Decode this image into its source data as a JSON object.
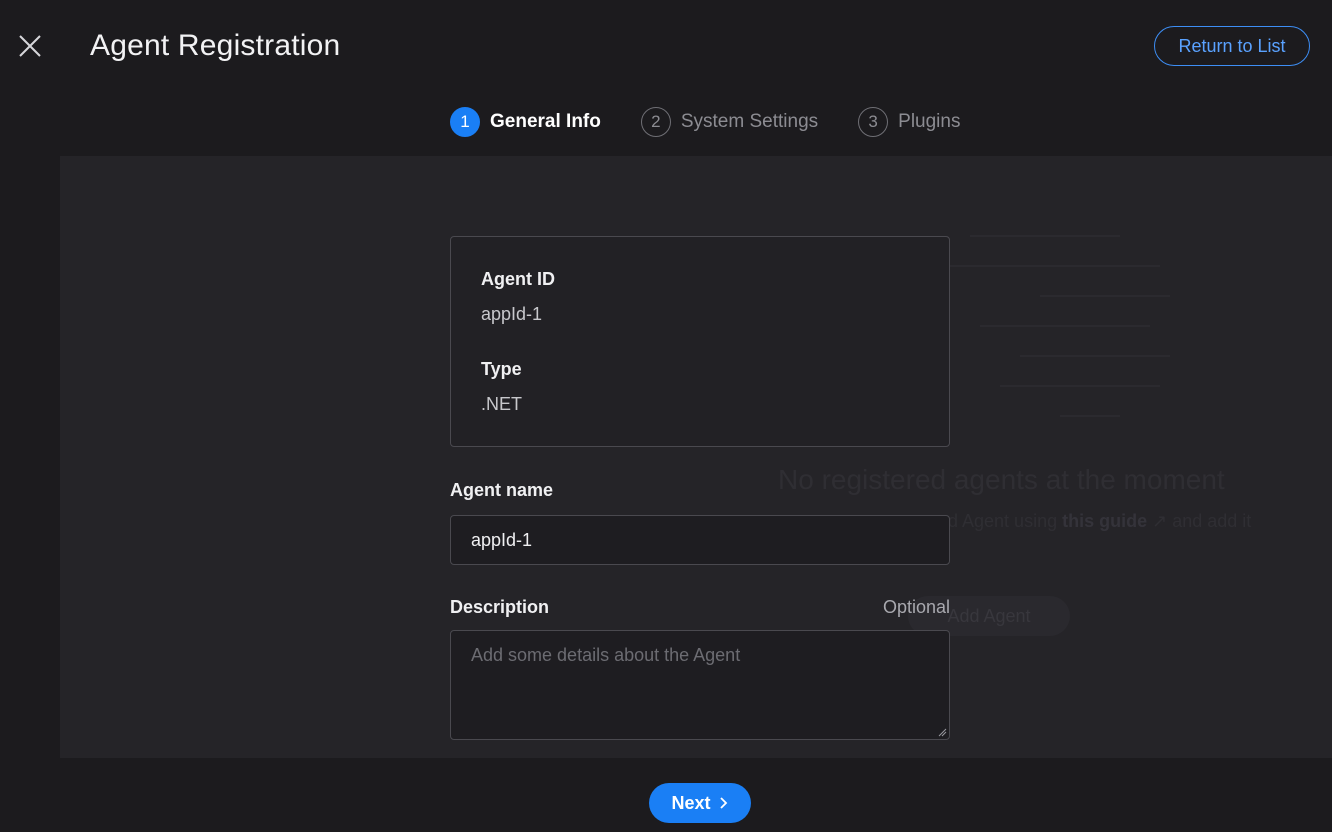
{
  "header": {
    "title": "Agent Registration",
    "close_icon": "close-icon",
    "return_button": "Return to List",
    "accent_color": "#1a7ff5"
  },
  "stepper": {
    "steps": [
      {
        "number": "1",
        "label": "General Info",
        "active": true
      },
      {
        "number": "2",
        "label": "System Settings",
        "active": false
      },
      {
        "number": "3",
        "label": "Plugins",
        "active": false
      }
    ]
  },
  "agent_info": {
    "id_label": "Agent ID",
    "id_value": "appId-1",
    "type_label": "Type",
    "type_value": ".NET"
  },
  "form": {
    "name_label": "Agent name",
    "name_value": "appId-1",
    "description_label": "Description",
    "description_optional": "Optional",
    "description_placeholder": "Add some details about the Agent"
  },
  "background_empty_state": {
    "title": "No registered agents at the moment",
    "desc_prefix": "d Agent using",
    "desc_link": "this guide",
    "desc_suffix": "and add it",
    "add_button": "Add Agent"
  },
  "footer": {
    "next_button": "Next",
    "next_icon": "chevron-right-icon"
  }
}
